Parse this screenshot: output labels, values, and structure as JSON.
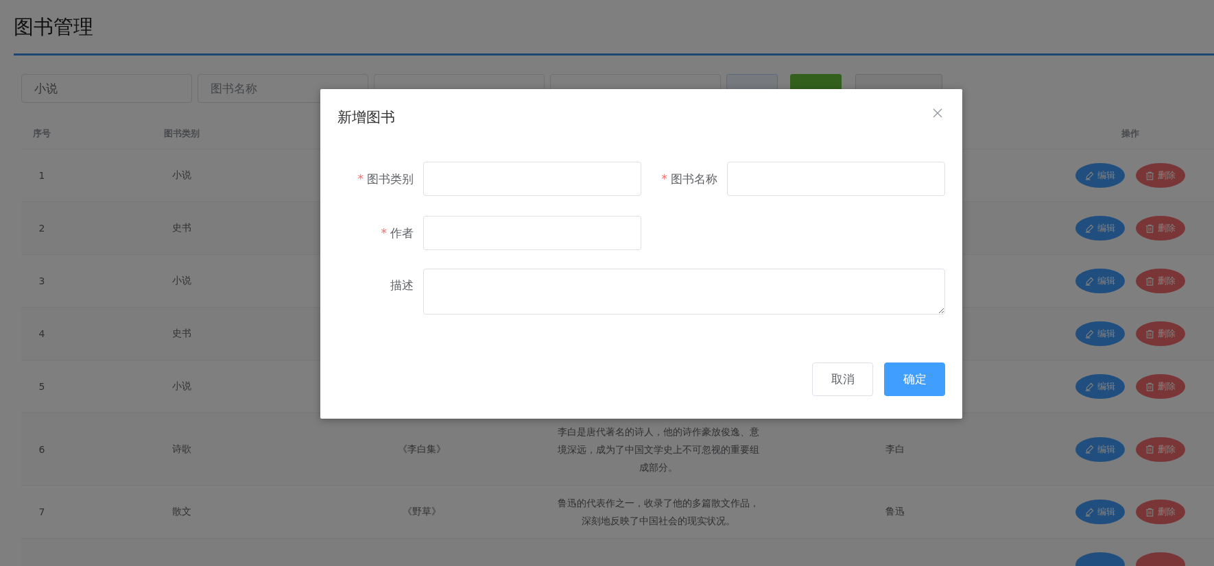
{
  "page": {
    "title": "图书管理"
  },
  "search": {
    "fields": [
      {
        "kind": "input",
        "value": "小说"
      },
      {
        "kind": "input",
        "placeholder": "图书名称"
      },
      {
        "kind": "input"
      },
      {
        "kind": "input"
      }
    ],
    "buttons": [
      {
        "kind": "query"
      },
      {
        "kind": "create"
      },
      {
        "kind": "reset"
      }
    ]
  },
  "table": {
    "columns": {
      "index": "序号",
      "category": "图书类别",
      "actions": "操作"
    },
    "rows": [
      {
        "index": "1",
        "category": "小说",
        "edit": "编辑",
        "delete": "删除"
      },
      {
        "index": "2",
        "category": "史书",
        "edit": "编辑",
        "delete": "删除"
      },
      {
        "index": "3",
        "category": "小说",
        "edit": "编辑",
        "delete": "删除"
      },
      {
        "index": "4",
        "category": "史书",
        "edit": "编辑",
        "delete": "删除"
      },
      {
        "index": "5",
        "category": "小说",
        "edit": "编辑",
        "delete": "删除"
      },
      {
        "index": "6",
        "category": "诗歌",
        "name": "《李白集》",
        "description": "李白是唐代著名的诗人，他的诗作豪放俊逸、意境深远，成为了中国文学史上不可忽视的重要组成部分。",
        "author": "李白",
        "edit": "编辑",
        "delete": "删除"
      },
      {
        "index": "7",
        "category": "散文",
        "name": "《野草》",
        "description": "鲁迅的代表作之一，收录了他的多篇散文作品，深刻地反映了中国社会的现实状况。",
        "author": "鲁迅",
        "edit": "编辑",
        "delete": "删除"
      },
      {}
    ]
  },
  "dialog": {
    "title": "新增图书",
    "fields": [
      {
        "kind": "input",
        "label": "图书类别",
        "asterisk": "*"
      },
      {
        "kind": "input",
        "label": "图书名称",
        "asterisk": "*"
      },
      {
        "kind": "input",
        "label": "作者",
        "asterisk": "*"
      },
      {
        "kind": "textarea",
        "label": "描述"
      }
    ],
    "buttons": [
      {
        "kind": "cancel",
        "label": "取消"
      },
      {
        "kind": "confirm",
        "label": "确定"
      }
    ]
  }
}
